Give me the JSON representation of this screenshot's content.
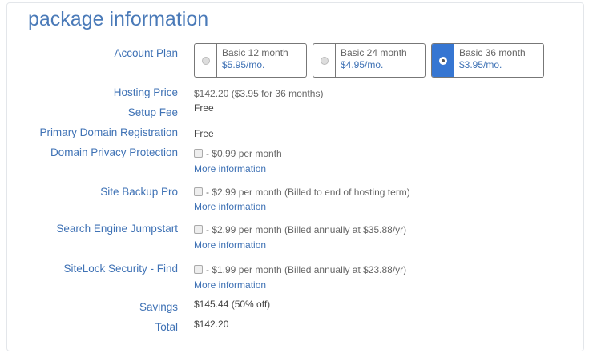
{
  "title": "package information",
  "labels": {
    "account_plan": "Account Plan",
    "hosting_price": "Hosting Price",
    "setup_fee": "Setup Fee",
    "primary_domain": "Primary Domain Registration",
    "domain_privacy": "Domain Privacy Protection",
    "site_backup": "Site Backup Pro",
    "search_engine": "Search Engine Jumpstart",
    "sitelock": "SiteLock Security - Find",
    "savings": "Savings",
    "total": "Total"
  },
  "plans": [
    {
      "name": "Basic 12 month",
      "price": "$5.95/mo.",
      "selected": false
    },
    {
      "name": "Basic 24 month",
      "price": "$4.95/mo.",
      "selected": false
    },
    {
      "name": "Basic 36 month",
      "price": "$3.95/mo.",
      "selected": true
    }
  ],
  "values": {
    "hosting_price": "$142.20  ($3.95 for 36 months)",
    "setup_fee": "Free",
    "primary_domain": "Free",
    "savings": "$145.44 (50% off)",
    "total": "$142.20"
  },
  "addons": {
    "domain_privacy": "- $0.99 per month",
    "site_backup": "- $2.99 per month (Billed to end of hosting term)",
    "search_engine": "- $2.99 per month (Billed annually at $35.88/yr)",
    "sitelock": "- $1.99 per month (Billed annually at $23.88/yr)"
  },
  "more_info": "More information",
  "colors": {
    "accent": "#3676d2",
    "label": "#3f72b5"
  }
}
